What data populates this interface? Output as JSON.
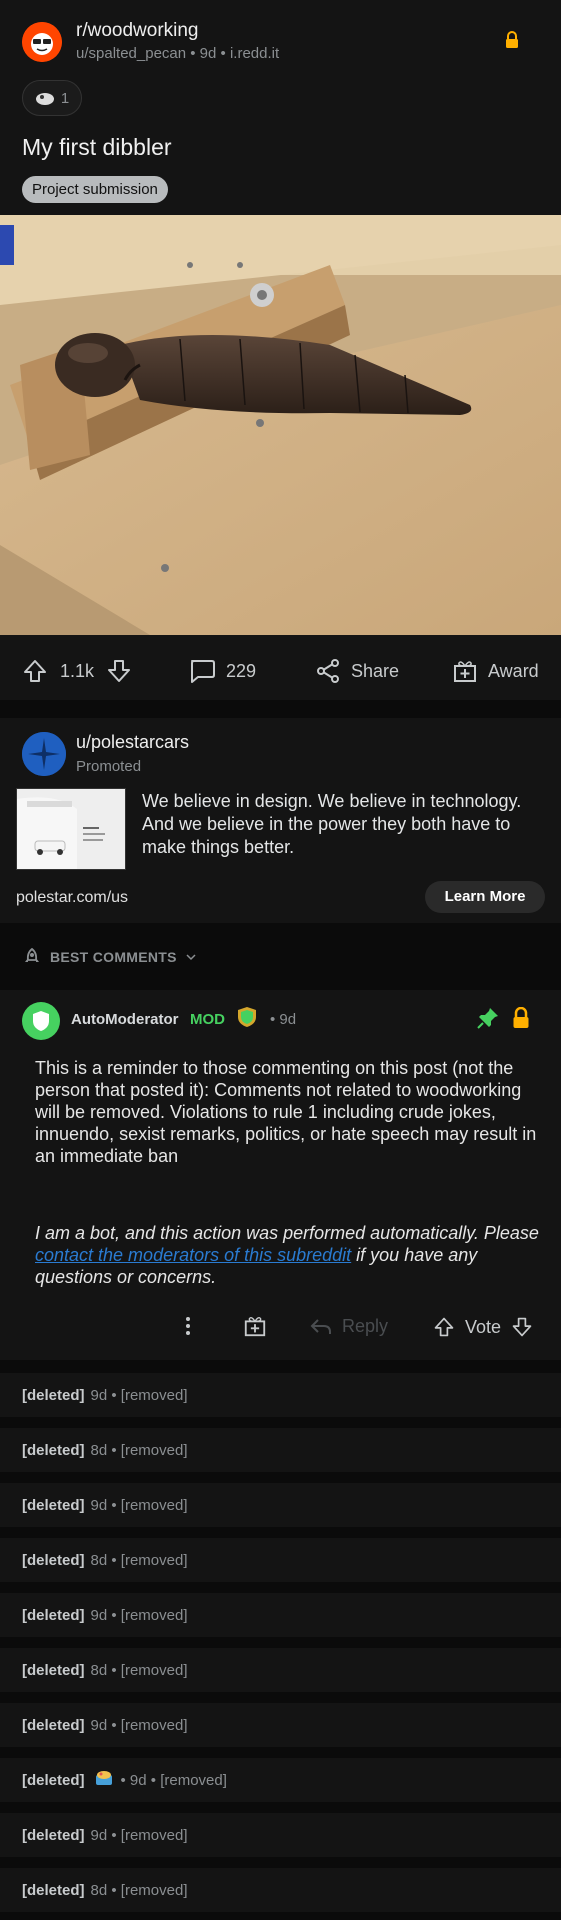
{
  "post": {
    "subreddit": "r/woodworking",
    "meta": "u/spalted_pecan • 9d • i.redd.it",
    "award_count": "1",
    "title": "My first dibbler",
    "flair": "Project submission",
    "upvotes": "1.1k",
    "comments": "229",
    "share_label": "Share",
    "award_label": "Award"
  },
  "ad": {
    "name": "u/polestarcars",
    "promoted": "Promoted",
    "text": "We believe in design. We believe in technology. And we believe in the power they both have to make things better.",
    "url": "polestar.com/us",
    "cta": "Learn More"
  },
  "sort": {
    "label": "BEST COMMENTS"
  },
  "mod_comment": {
    "author": "AutoModerator",
    "badge": "MOD",
    "time": "• 9d",
    "body": "This is a reminder to those commenting on this post (not the person that posted it): Comments not related to woodworking will be removed. Violations to rule 1 including crude jokes, innuendo, sexist remarks, politics, or hate speech may result in an immediate ban",
    "bot_pre": "I am a bot, and this action was performed automatically. Please ",
    "bot_link": "contact the moderators of this subreddit",
    "bot_post": " if you have any questions or concerns.",
    "reply_label": "Reply",
    "vote_label": "Vote"
  },
  "deleted_comments": [
    {
      "user": "[deleted]",
      "rest": "9d • [removed]"
    },
    {
      "user": "[deleted]",
      "rest": "8d • [removed]"
    },
    {
      "user": "[deleted]",
      "rest": "9d • [removed]"
    },
    {
      "user": "[deleted]",
      "rest": "8d • [removed]"
    },
    {
      "user": "[deleted]",
      "rest": "9d • [removed]"
    },
    {
      "user": "[deleted]",
      "rest": "8d • [removed]"
    },
    {
      "user": "[deleted]",
      "rest": "9d • [removed]"
    },
    {
      "user": "[deleted]",
      "rest": "• 9d • [removed]"
    },
    {
      "user": "[deleted]",
      "rest": "9d • [removed]"
    },
    {
      "user": "[deleted]",
      "rest": "8d • [removed]"
    }
  ],
  "colors": {
    "accent_green": "#46d160",
    "lock_yellow": "#ffb000",
    "link_blue": "#2a7bd1"
  }
}
